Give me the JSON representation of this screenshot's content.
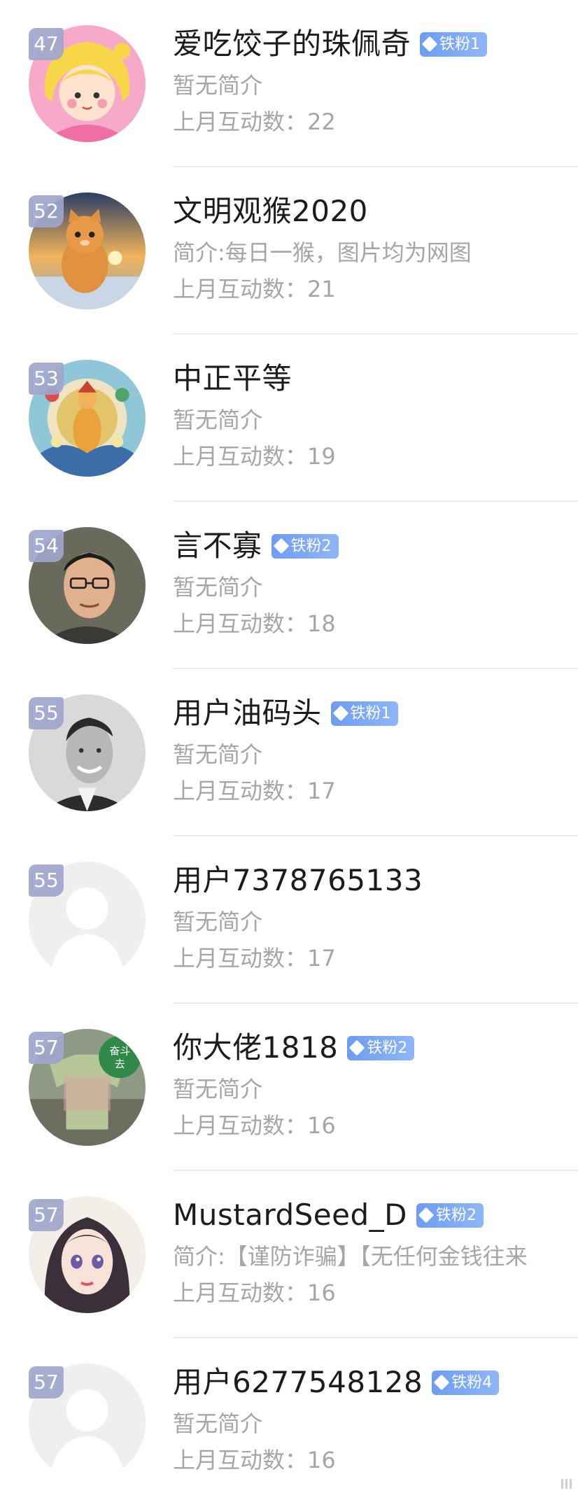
{
  "fans": [
    {
      "rank": "47",
      "name": "爱吃饺子的珠佩奇",
      "badge": "铁粉1",
      "intro": "暂无简介",
      "interactions": "上月互动数：22",
      "avatar": "cartoon-girl-icon"
    },
    {
      "rank": "52",
      "name": "文明观猴2020",
      "badge": "",
      "intro": "简介:每日一猴，图片均为网图",
      "interactions": "上月互动数：21",
      "avatar": "cat-icon"
    },
    {
      "rank": "53",
      "name": "中正平等",
      "badge": "",
      "intro": "暂无简介",
      "interactions": "上月互动数：19",
      "avatar": "deity-painting-icon"
    },
    {
      "rank": "54",
      "name": "言不寡",
      "badge": "铁粉2",
      "intro": "暂无简介",
      "interactions": "上月互动数：18",
      "avatar": "man-glasses-icon"
    },
    {
      "rank": "55",
      "name": "用户油码头",
      "badge": "铁粉1",
      "intro": "暂无简介",
      "interactions": "上月互动数：17",
      "avatar": "vintage-man-icon"
    },
    {
      "rank": "55",
      "name": "用户7378765133",
      "badge": "",
      "intro": "暂无简介",
      "interactions": "上月互动数：17",
      "avatar": "default-user-icon"
    },
    {
      "rank": "57",
      "name": "你大佬1818",
      "badge": "铁粉2",
      "intro": "暂无简介",
      "interactions": "上月互动数：16",
      "avatar": "money-shirt-icon",
      "avatar_text": "奋斗去"
    },
    {
      "rank": "57",
      "name": "MustardSeed_D",
      "badge": "铁粉2",
      "intro": "简介:【谨防诈骗】【无任何金钱往来",
      "interactions": "上月互动数：16",
      "avatar": "anime-girl-icon"
    },
    {
      "rank": "57",
      "name": "用户6277548128",
      "badge": "铁粉4",
      "intro": "暂无简介",
      "interactions": "上月互动数：16",
      "avatar": "default-user-icon"
    }
  ],
  "colors": {
    "name": "#1c1c1c",
    "secondary_text": "#a6a6a6",
    "badge_start": "#6d9cf2",
    "badge_end": "#8fb6f7",
    "rank_badge": "#a0a6cc",
    "divider": "#ececec"
  }
}
